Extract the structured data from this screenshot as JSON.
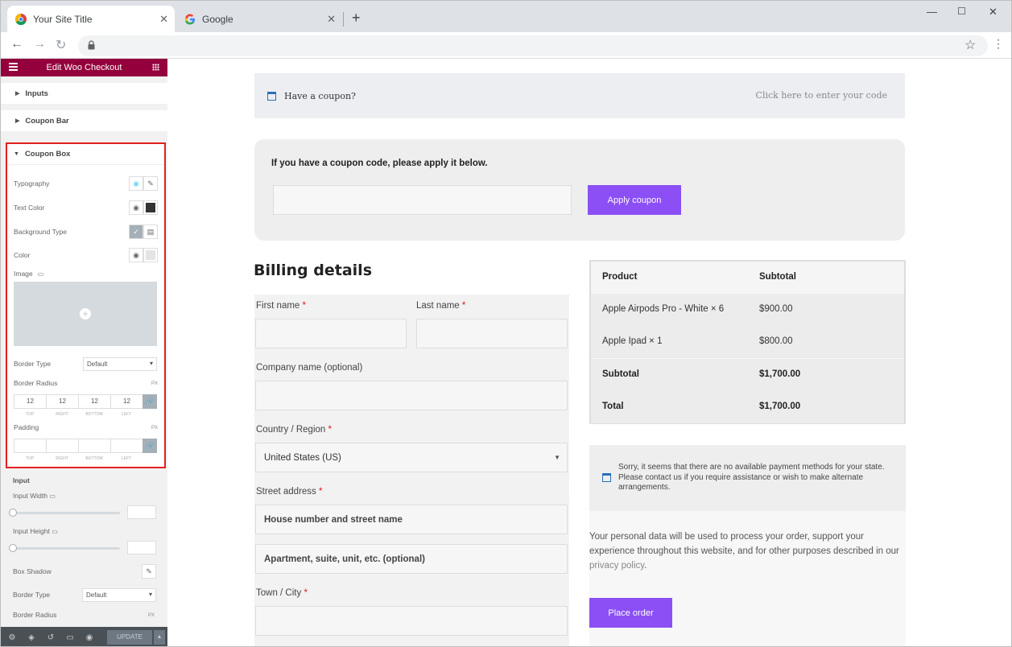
{
  "browser": {
    "tabs": [
      {
        "title": "Your Site Title",
        "active": true
      },
      {
        "title": "Google",
        "active": false
      }
    ]
  },
  "editor": {
    "panel_title": "Edit Woo Checkout",
    "sections": {
      "inputs": "Inputs",
      "coupon_bar": "Coupon Bar",
      "coupon_box": "Coupon Box"
    },
    "controls": {
      "typography": "Typography",
      "text_color": "Text Color",
      "background_type": "Background Type",
      "color": "Color",
      "image": "Image",
      "border_type": "Border Type",
      "border_type_value": "Default",
      "border_radius": "Border Radius",
      "unit": "PX",
      "radius_values": [
        "12",
        "12",
        "12",
        "12"
      ],
      "dim_labels": [
        "TOP",
        "RIGHT",
        "BOTTOM",
        "LEFT"
      ],
      "padding": "Padding",
      "input_heading": "Input",
      "input_width": "Input Width",
      "input_height": "Input Height",
      "box_shadow": "Box Shadow",
      "border_type_2": "Border Type",
      "border_type_2_value": "Default",
      "border_radius_2": "Border Radius"
    },
    "footer": {
      "update_label": "UPDATE"
    }
  },
  "page": {
    "coupon_bar": {
      "left_text": "Have a coupon?",
      "right_text": "Click here to enter your code"
    },
    "coupon_box": {
      "prompt": "If you have a coupon code, please apply it below.",
      "button": "Apply coupon"
    },
    "billing": {
      "title": "Billing details",
      "first_name": "First name",
      "last_name": "Last name",
      "company": "Company name (optional)",
      "country_label": "Country / Region",
      "country_value": "United States (US)",
      "street_label": "Street address",
      "street_placeholder_1": "House number and street name",
      "street_placeholder_2": "Apartment, suite, unit, etc. (optional)",
      "town_label": "Town / City",
      "required_mark": "*"
    },
    "order": {
      "header": {
        "product": "Product",
        "subtotal": "Subtotal"
      },
      "rows": [
        {
          "product": "Apple Airpods Pro - White  × 6",
          "subtotal": "$900.00"
        },
        {
          "product": "Apple Ipad  × 1",
          "subtotal": "$800.00"
        }
      ],
      "subtotal": {
        "label": "Subtotal",
        "value": "$1,700.00"
      },
      "total": {
        "label": "Total",
        "value": "$1,700.00"
      }
    },
    "payment": {
      "message": "Sorry, it seems that there are no available payment methods for your state. Please contact us if you require assistance or wish to make alternate arrangements.",
      "privacy_text": "Your personal data will be used to process your order, support your experience throughout this website, and for other purposes described in our",
      "privacy_link": "privacy policy",
      "privacy_end": ".",
      "place_order": "Place order"
    }
  },
  "colors": {
    "accent": "#8b4ff5",
    "editor_header": "#93003c",
    "highlight_border": "#e02020"
  }
}
